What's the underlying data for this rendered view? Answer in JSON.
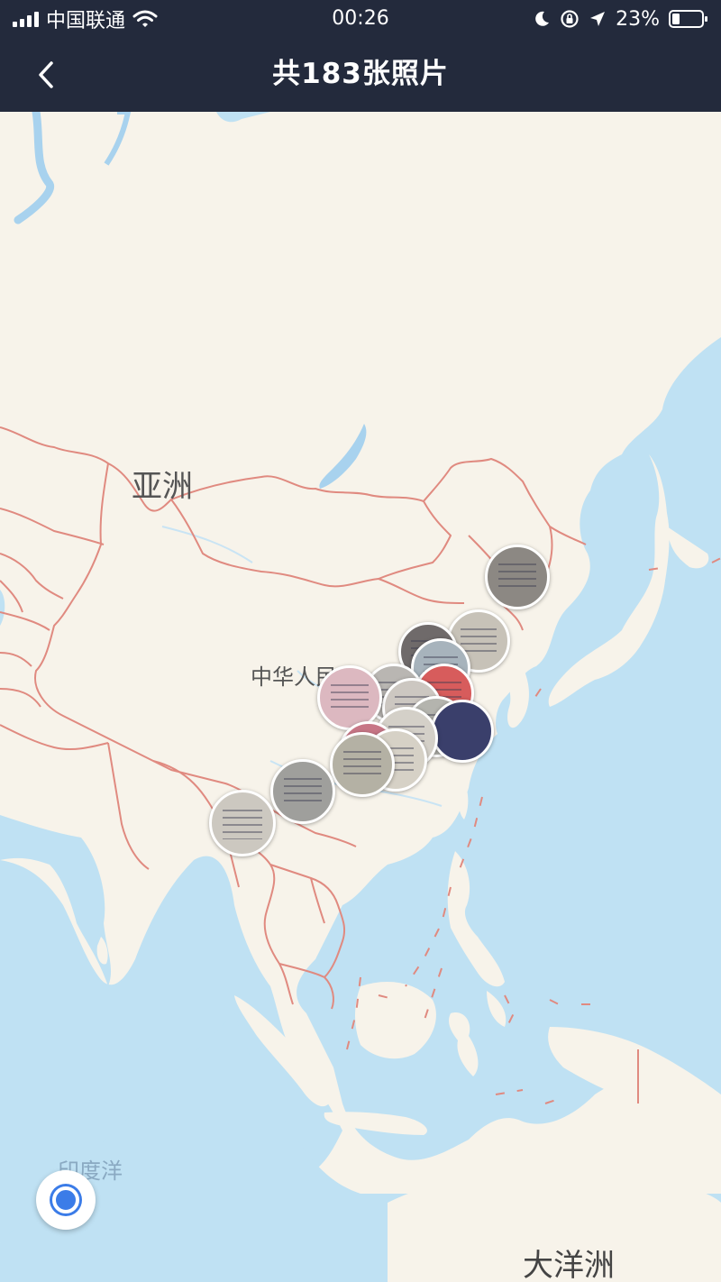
{
  "status_bar": {
    "carrier": "中国联通",
    "time": "00:26",
    "battery": "23%",
    "icons": [
      "signal-icon",
      "wifi-icon",
      "moon-icon",
      "rotation-lock-icon",
      "location-arrow-icon",
      "battery-icon"
    ]
  },
  "nav": {
    "title": "共183张照片",
    "back_icon": "chevron-left-icon"
  },
  "map": {
    "labels": {
      "asia": "亚洲",
      "china": "中华人民",
      "indian_ocean": "印度洋",
      "oceania": "大洋洲"
    },
    "colors": {
      "land": "#f7f3ea",
      "water": "#bfe1f3",
      "border": "#e08a80",
      "river": "#a8d2ee"
    },
    "photo_pins": [
      {
        "id": "pin-1",
        "color": "#8c8883"
      },
      {
        "id": "pin-2",
        "color": "#c7c2b8"
      },
      {
        "id": "pin-3",
        "color": "#a7b3bc"
      },
      {
        "id": "pin-4",
        "color": "#6f6a6a"
      },
      {
        "id": "pin-5",
        "color": "#b9b6b2"
      },
      {
        "id": "pin-6",
        "color": "#d75c5c"
      },
      {
        "id": "pin-7",
        "color": "#ccc7c1"
      },
      {
        "id": "pin-8",
        "color": "#dcb8c0"
      },
      {
        "id": "pin-9",
        "color": "#b4b4ae"
      },
      {
        "id": "pin-10",
        "color": "#3a3f6b"
      },
      {
        "id": "pin-11",
        "color": "#d4d0c8"
      },
      {
        "id": "pin-12",
        "color": "#c77686"
      },
      {
        "id": "pin-13",
        "color": "#b4b1a4"
      },
      {
        "id": "pin-14",
        "color": "#9f9f9c"
      },
      {
        "id": "pin-15",
        "color": "#d6d1c6"
      }
    ],
    "location_button_icon": "locate-me-icon"
  }
}
